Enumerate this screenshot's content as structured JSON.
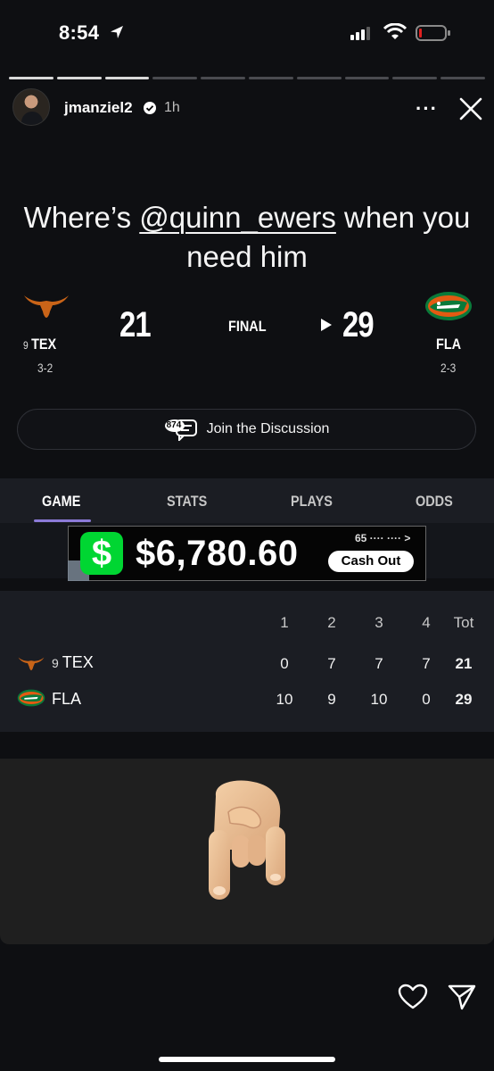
{
  "status_bar": {
    "time": "8:54"
  },
  "story": {
    "username": "jmanziel2",
    "time_ago": "1h",
    "caption_prefix": "Where’s ",
    "caption_mention": "@quinn_ewers",
    "caption_suffix": " when you need him",
    "segments_total": 10,
    "segments_done": 3
  },
  "scoreboard": {
    "status": "FINAL",
    "away": {
      "rank": "9",
      "abbr": "TEX",
      "record": "3-2",
      "score": "21",
      "color": "#c96418"
    },
    "home": {
      "abbr": "FLA",
      "record": "2-3",
      "score": "29",
      "color": "#0a7a3a"
    }
  },
  "discussion": {
    "count": "874",
    "label": "Join the Discussion"
  },
  "tabs": [
    {
      "label": "GAME",
      "active": true
    },
    {
      "label": "STATS",
      "active": false
    },
    {
      "label": "PLAYS",
      "active": false
    },
    {
      "label": "ODDS",
      "active": false
    }
  ],
  "ad": {
    "symbol": "$",
    "amount": "$6,780.60",
    "sub": "65 ···· ···· >",
    "button": "Cash Out",
    "accent": "#00d632"
  },
  "boxscore": {
    "headers": [
      "1",
      "2",
      "3",
      "4",
      "Tot"
    ],
    "rows": [
      {
        "rank": "9",
        "team": "TEX",
        "periods": [
          "0",
          "7",
          "7",
          "7"
        ],
        "total": "21"
      },
      {
        "team": "FLA",
        "periods": [
          "10",
          "9",
          "10",
          "0"
        ],
        "total": "29"
      }
    ]
  },
  "reaction_emoji": "sign-of-the-horns-hand-icon"
}
